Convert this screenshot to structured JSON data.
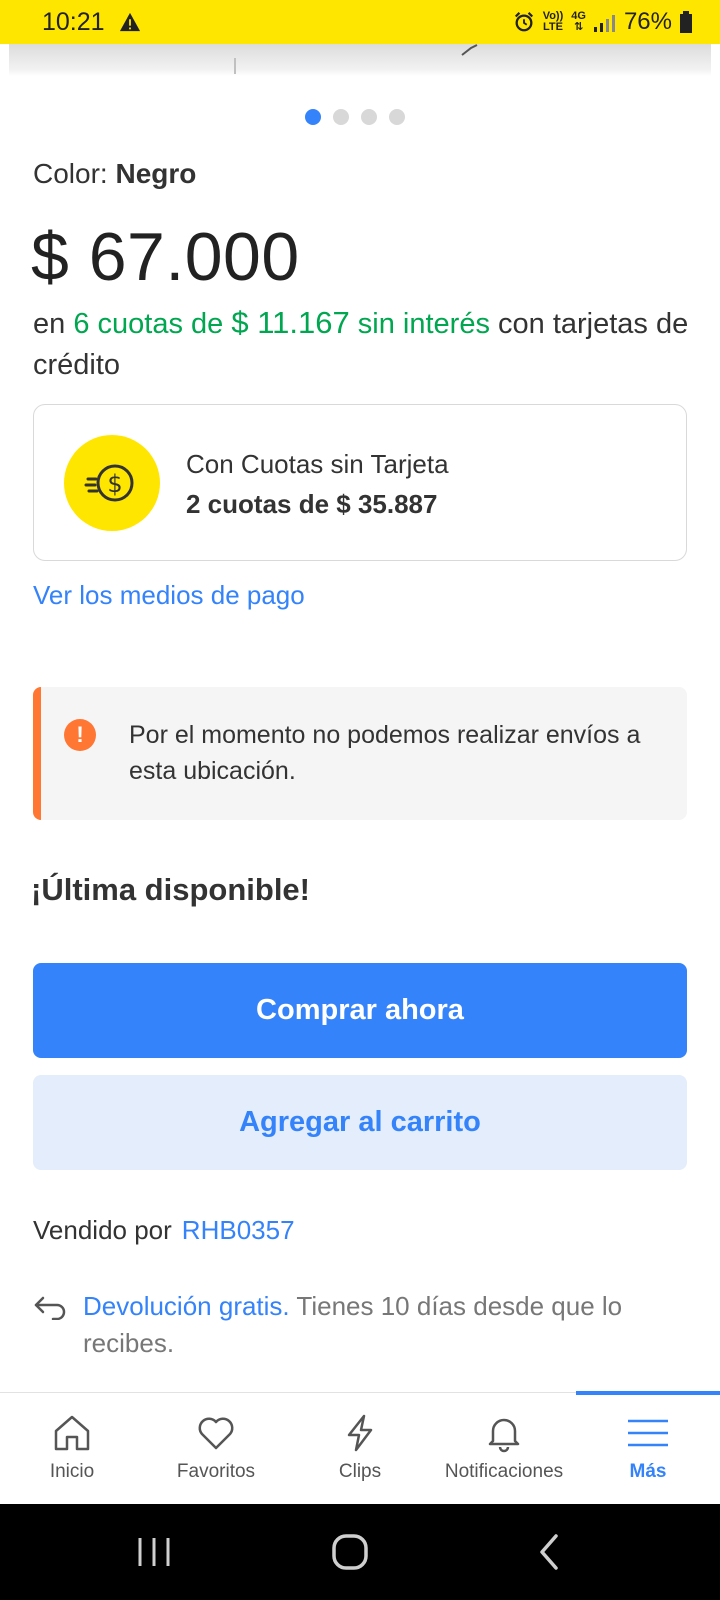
{
  "status_bar": {
    "time": "10:21",
    "network_top": "Vo))",
    "network_bottom": "LTE",
    "data_top": "4G",
    "battery": "76%"
  },
  "carousel": {
    "dots": 4,
    "active_index": 0
  },
  "product": {
    "color_label": "Color:",
    "color_value": "Negro",
    "price": "$ 67.000",
    "installments_prefix": "en",
    "installments_green": "6 cuotas de",
    "installments_amount": "$ 11.167",
    "installments_interest": "sin interés",
    "installments_suffix": "con tarjetas de crédito"
  },
  "cuotas_card": {
    "title": "Con Cuotas sin Tarjeta",
    "value": "2 cuotas de $ 35.887",
    "icon": "coin-dollar-icon"
  },
  "payment_link": "Ver los medios de pago",
  "alert": {
    "text": "Por el momento no podemos realizar envíos a esta ubicación.",
    "icon": "!"
  },
  "stock_label": "¡Última disponible!",
  "buttons": {
    "buy_now": "Comprar ahora",
    "add_to_cart": "Agregar al carrito"
  },
  "seller": {
    "label": "Vendido por",
    "name": "RHB0357"
  },
  "returns": {
    "link": "Devolución gratis.",
    "text": "Tienes 10 días desde que lo recibes."
  },
  "bottom_nav": {
    "items": [
      {
        "label": "Inicio",
        "icon": "home-icon"
      },
      {
        "label": "Favoritos",
        "icon": "heart-icon"
      },
      {
        "label": "Clips",
        "icon": "lightning-icon"
      },
      {
        "label": "Notificaciones",
        "icon": "bell-icon"
      },
      {
        "label": "Más",
        "icon": "menu-icon"
      }
    ],
    "active_index": 4
  },
  "colors": {
    "accent": "#3483fa",
    "brand_yellow": "#ffe600",
    "green": "#00a650",
    "warning": "#ff7733"
  }
}
